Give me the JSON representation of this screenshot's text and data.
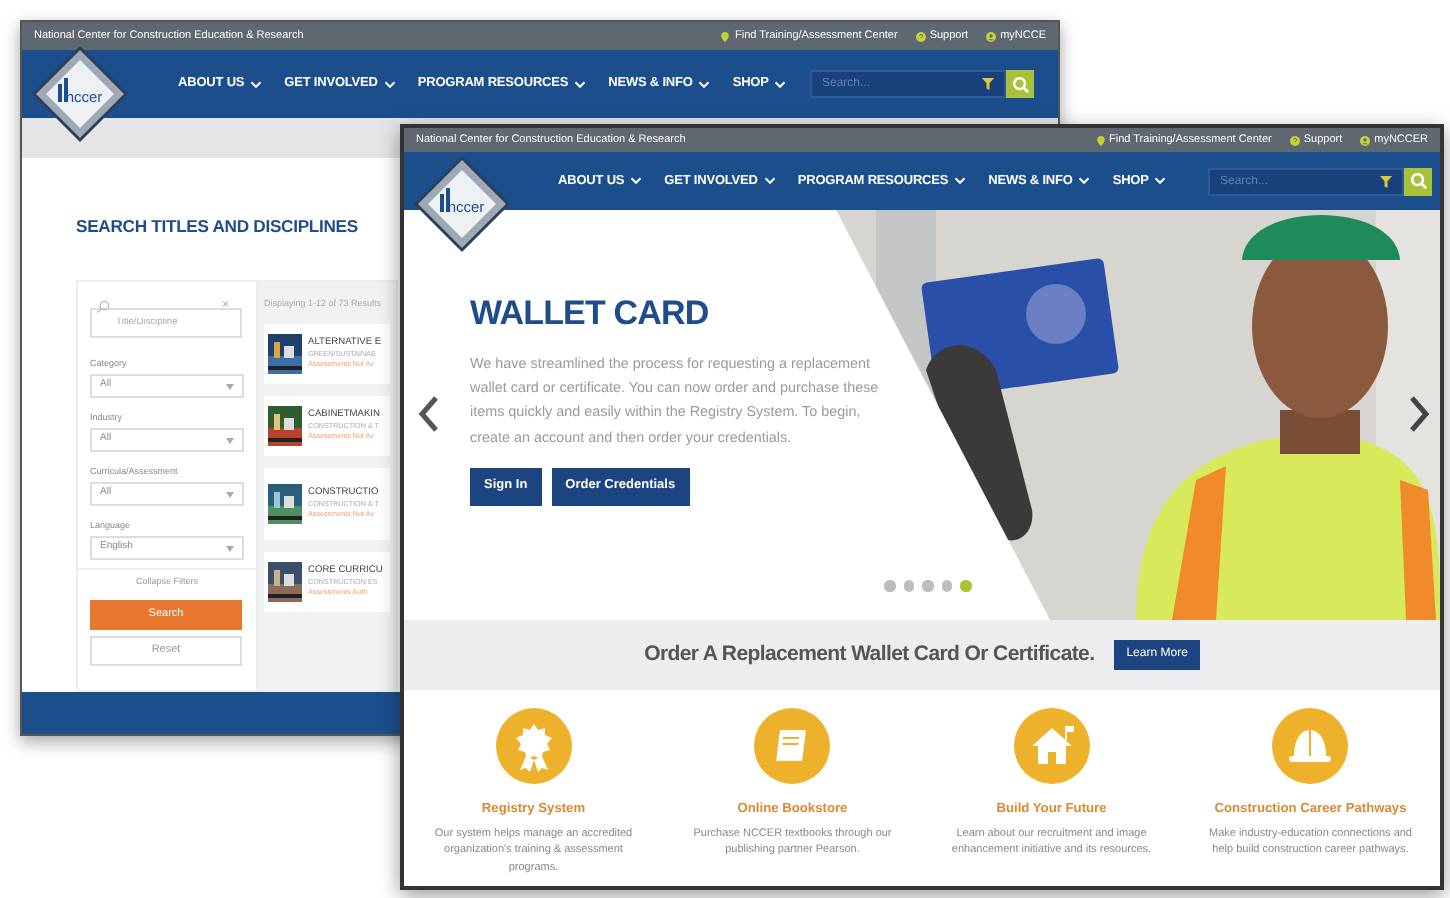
{
  "back_page": {
    "top_bar": {
      "org_name": "National Center for Construction Education & Research",
      "links": [
        {
          "kind": "location",
          "label": "Find Training/Assessment Center"
        },
        {
          "kind": "help",
          "label": "Support"
        },
        {
          "kind": "user",
          "label": "myNCCE"
        }
      ]
    },
    "logo_text": "nccer",
    "nav": [
      {
        "label": "ABOUT US"
      },
      {
        "label": "GET INVOLVED"
      },
      {
        "label": "PROGRAM RESOURCES"
      },
      {
        "label": "NEWS & INFO"
      },
      {
        "label": "SHOP"
      }
    ],
    "search": {
      "placeholder": "Search..."
    },
    "title": "SEARCH TITLES AND DISCIPLINES",
    "filters": {
      "search_placeholder": "Title/Discipline",
      "clear": "×",
      "fields": [
        {
          "label": "Category",
          "value": "All"
        },
        {
          "label": "Industry",
          "value": "All"
        },
        {
          "label": "Curricula/Assessment",
          "value": "All"
        },
        {
          "label": "Language",
          "value": "English"
        }
      ],
      "collapse": "Collapse Filters",
      "search_button": "Search",
      "reset_button": "Reset"
    },
    "results": {
      "summary": "Displaying 1-12 of 73 Results",
      "items": [
        {
          "title": "ALTERNATIVE E",
          "subtitle": "GREEN/SUSTAINAB",
          "status": "Assessments Not Av"
        },
        {
          "title": "CABINETMAKIN",
          "subtitle": "CONSTRUCTION & T",
          "status": "Assessments Not Av"
        },
        {
          "title": "CONSTRUCTIO",
          "subtitle": "CONSTRUCTION & T",
          "status": "Assessments Not Av"
        },
        {
          "title": "CORE CURRICU",
          "subtitle": "CONSTRUCTION ES",
          "status": "Assessments Auth"
        }
      ]
    }
  },
  "front_page": {
    "top_bar": {
      "org_name": "National Center for Construction Education & Research",
      "links": [
        {
          "kind": "location",
          "label": "Find Training/Assessment Center"
        },
        {
          "kind": "help",
          "label": "Support"
        },
        {
          "kind": "user",
          "label": "myNCCER"
        }
      ]
    },
    "logo_text": "nccer",
    "nav": [
      {
        "label": "ABOUT US"
      },
      {
        "label": "GET INVOLVED"
      },
      {
        "label": "PROGRAM RESOURCES"
      },
      {
        "label": "NEWS & INFO"
      },
      {
        "label": "SHOP"
      }
    ],
    "search": {
      "placeholder": "Search..."
    },
    "hero": {
      "title": "WALLET CARD",
      "text": "We have streamlined the process for requesting a replacement wallet card or certificate. You can now order and purchase these items quickly and easily within the Registry System. To begin, create an account and then order your credentials.",
      "buttons": [
        {
          "label": "Sign In"
        },
        {
          "label": "Order Credentials"
        }
      ],
      "slides": [
        {
          "selected": false
        },
        {
          "selected": false
        },
        {
          "selected": false
        },
        {
          "selected": false
        },
        {
          "selected": true
        }
      ]
    },
    "promo": {
      "text": "Order A Replacement Wallet Card Or Certificate.",
      "button": "Learn More"
    },
    "features": [
      {
        "kind": "award",
        "title": "Registry System",
        "text": "Our system helps manage an accredited organization's training & assessment programs."
      },
      {
        "kind": "book",
        "title": "Online Bookstore",
        "text": "Purchase NCCER textbooks through our publishing partner Pearson."
      },
      {
        "kind": "house",
        "title": "Build Your Future",
        "text": "Learn about our recruitment and image enhancement initiative and its resources."
      },
      {
        "kind": "hardhat",
        "title": "Construction Career Pathways",
        "text": "Make industry-education connections and help build construction career pathways."
      }
    ]
  }
}
